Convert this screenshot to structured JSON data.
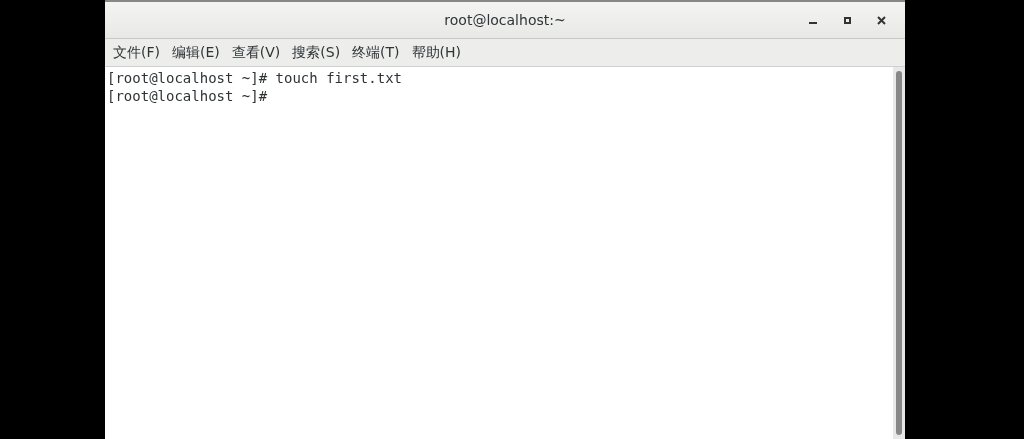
{
  "window": {
    "title": "root@localhost:~"
  },
  "title_bar_buttons": [
    {
      "kind": "minimize"
    },
    {
      "kind": "maximize"
    },
    {
      "kind": "close"
    }
  ],
  "menu": [
    "文件(F)",
    "编辑(E)",
    "查看(V)",
    "搜索(S)",
    "终端(T)",
    "帮助(H)"
  ],
  "terminal": {
    "lines": [
      "[root@localhost ~]# touch first.txt",
      "[root@localhost ~]# "
    ]
  }
}
